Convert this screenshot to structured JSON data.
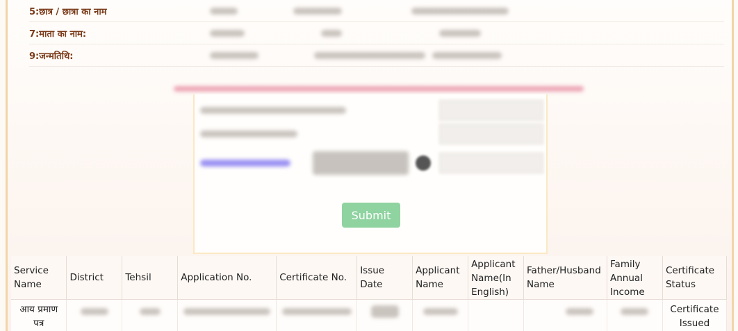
{
  "form": {
    "fields": [
      {
        "label": "5:छात्र / छात्रा का नाम"
      },
      {
        "label": "7:माता का नाम:"
      },
      {
        "label": "9:जन्मतिथि:"
      }
    ],
    "submit_label": "Submit"
  },
  "table": {
    "headers": [
      "Service Name",
      "District",
      "Tehsil",
      "Application No.",
      "Certificate No.",
      "Issue Date",
      "Applicant Name",
      "Applicant Name(In English)",
      "Father/Husband Name",
      "Family Annual Income",
      "Certificate Status"
    ],
    "rows": [
      {
        "service_name": "आय प्रमाण पत्र",
        "certificate_status": "Certificate Issued"
      }
    ]
  },
  "colors": {
    "label_brown": "#7a3b1a",
    "submit_green": "#8fd3a0",
    "border_cream": "#f3d4a8"
  }
}
